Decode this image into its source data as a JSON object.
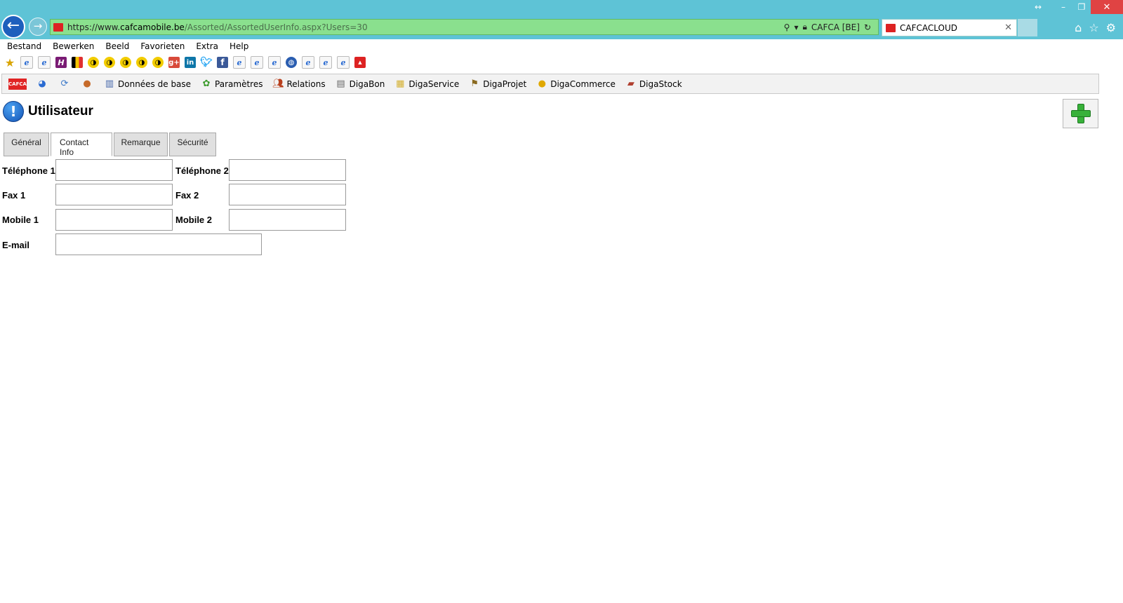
{
  "browser": {
    "address": {
      "scheme": "https://www.",
      "domain": "cafcamobile.be",
      "path": "/Assorted/AssortedUserInfo.aspx?Users=30",
      "certificate": "CAFCA [BE]"
    },
    "tab": {
      "title": "CAFCACLOUD"
    },
    "icons": {
      "back": "back-arrow-icon",
      "forward": "forward-arrow-icon",
      "search": "search-icon",
      "lock": "lock-icon",
      "refresh": "refresh-icon",
      "home": "home-icon",
      "favorites": "star-icon",
      "settings": "gear-icon"
    }
  },
  "menu": {
    "items": [
      "Bestand",
      "Bewerken",
      "Beeld",
      "Favorieten",
      "Extra",
      "Help"
    ]
  },
  "app_toolbar": {
    "items": [
      {
        "label": "Données de base",
        "icon": "database-icon"
      },
      {
        "label": "Paramètres",
        "icon": "settings-icon"
      },
      {
        "label": "Relations",
        "icon": "people-icon"
      },
      {
        "label": "DigaBon",
        "icon": "document-icon"
      },
      {
        "label": "DigaService",
        "icon": "folder-icon"
      },
      {
        "label": "DigaProjet",
        "icon": "project-icon"
      },
      {
        "label": "DigaCommerce",
        "icon": "coin-icon"
      },
      {
        "label": "DigaStock",
        "icon": "stock-icon"
      }
    ]
  },
  "page": {
    "title": "Utilisateur",
    "tabs": [
      "Général",
      "Contact Info",
      "Remarque",
      "Sécurité"
    ],
    "active_tab": "Contact Info",
    "fields": {
      "phone1": {
        "label": "Téléphone 1",
        "value": ""
      },
      "phone2": {
        "label": "Téléphone 2",
        "value": ""
      },
      "fax1": {
        "label": "Fax 1",
        "value": ""
      },
      "fax2": {
        "label": "Fax 2",
        "value": ""
      },
      "mobile1": {
        "label": "Mobile 1",
        "value": ""
      },
      "mobile2": {
        "label": "Mobile 2",
        "value": ""
      },
      "email": {
        "label": "E-mail",
        "value": ""
      }
    }
  },
  "colors": {
    "titlebar": "#5ec3d6",
    "address_secure": "#8ae08e",
    "close_button": "#e04343",
    "add_button_green": "#38b13a"
  }
}
